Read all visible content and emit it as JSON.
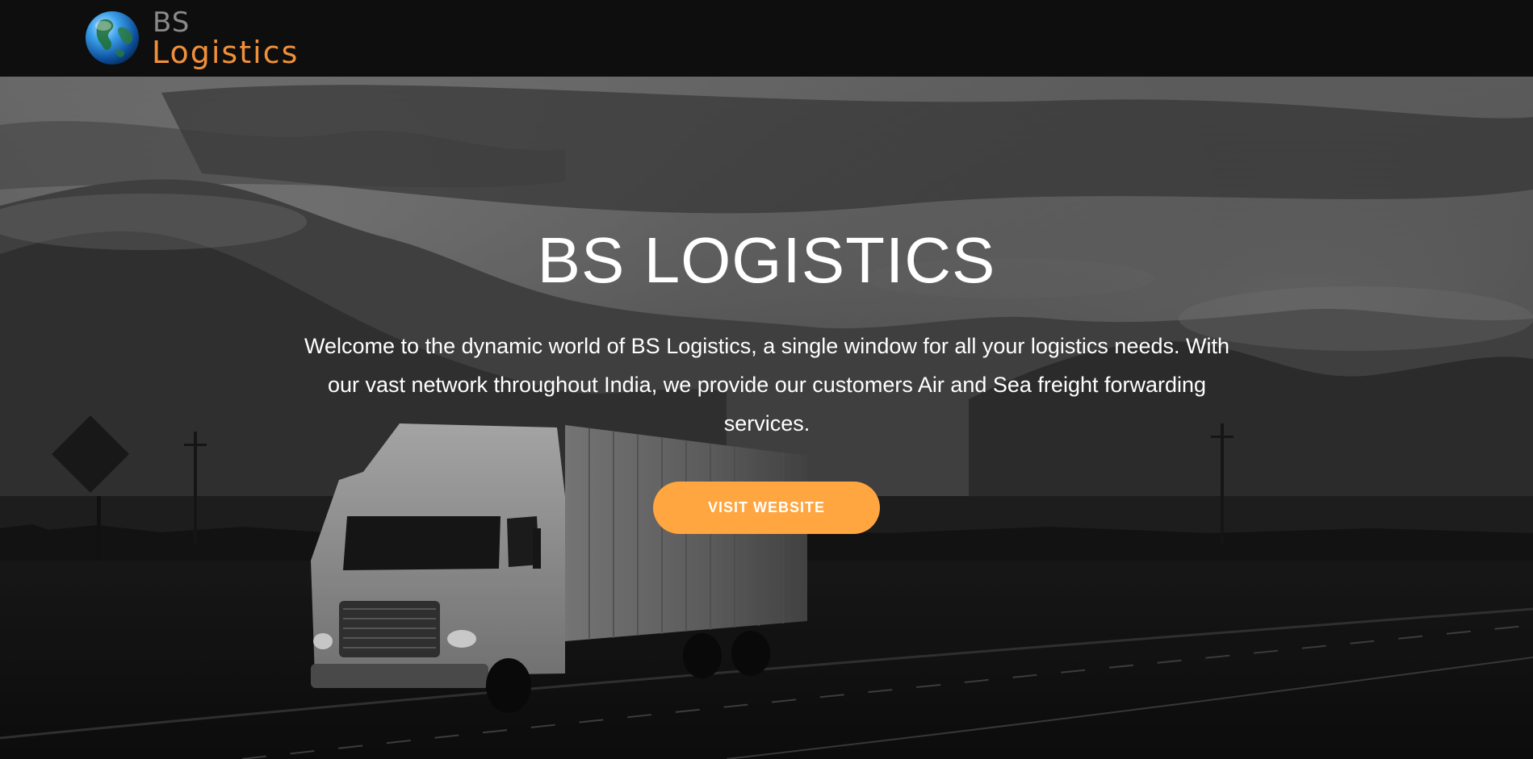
{
  "header": {
    "logo": {
      "line1": "BS",
      "line2": "Logistics",
      "icon": "globe-icon",
      "colors": {
        "bs_text": "#8a8a8a",
        "logistics_text": "#f0903a",
        "globe": "#2b8fe0"
      }
    },
    "background": "#0e0e0e"
  },
  "hero": {
    "title": "BS LOGISTICS",
    "description": "Welcome to the dynamic world of BS Logistics, a single window for all your logistics needs. With our vast network throughout India, we provide our customers Air and Sea freight forwarding services.",
    "button_label": "VISIT WEBSITE",
    "background_image": "grayscale photo of a semi truck on a highway in front of cloudy mountains",
    "colors": {
      "button": "#ffa640",
      "text": "#ffffff"
    }
  }
}
